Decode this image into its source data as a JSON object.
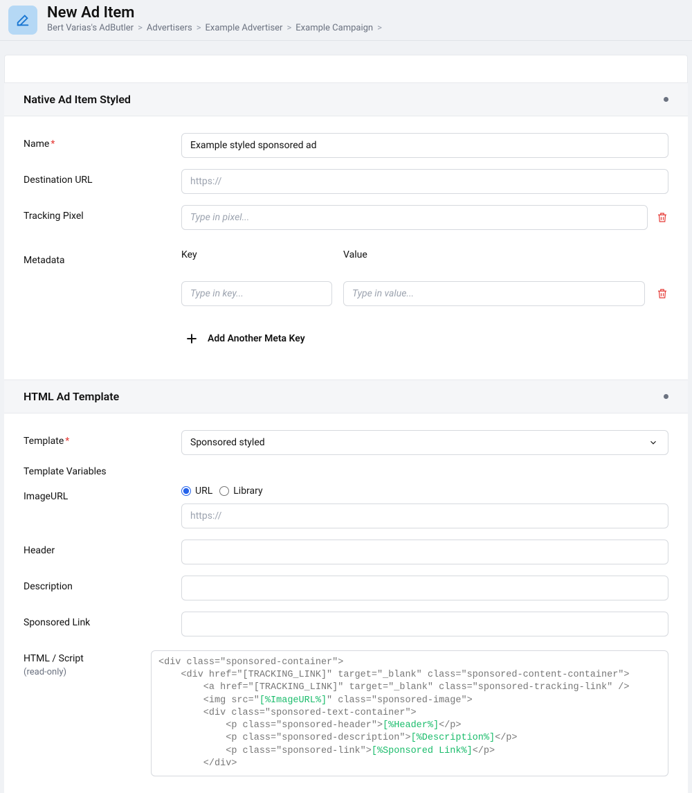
{
  "header": {
    "title": "New Ad Item",
    "breadcrumbs": [
      "Bert Varias's AdButler",
      "Advertisers",
      "Example Advertiser",
      "Example Campaign",
      ""
    ]
  },
  "sections": {
    "native": {
      "title": "Native Ad Item Styled",
      "fields": {
        "name_label": "Name",
        "name_value": "Example styled sponsored ad",
        "dest_label": "Destination URL",
        "dest_placeholder": "https://",
        "pixel_label": "Tracking Pixel",
        "pixel_placeholder": "Type in pixel...",
        "meta_label": "Metadata",
        "meta_key_label": "Key",
        "meta_val_label": "Value",
        "meta_key_placeholder": "Type in key...",
        "meta_val_placeholder": "Type in value...",
        "add_meta_label": "Add Another Meta Key"
      }
    },
    "template": {
      "title": "HTML Ad Template",
      "fields": {
        "template_label": "Template",
        "template_value": "Sponsored styled",
        "vars_heading": "Template Variables",
        "imageurl_label": "ImageURL",
        "radio_url": "URL",
        "radio_library": "Library",
        "imageurl_placeholder": "https://",
        "header_label": "Header",
        "description_label": "Description",
        "sponsored_label": "Sponsored Link",
        "html_label": "HTML / Script",
        "html_sublabel": "(read-only)",
        "code": {
          "l1": "<div class=\"sponsored-container\">",
          "l2": "    <div href=\"[TRACKING_LINK]\" target=\"_blank\" class=\"sponsored-content-container\">",
          "l3a": "        <a href=\"[TRACKING_LINK]\" target=\"_blank\" class=\"sponsored-tracking-link\" />",
          "l4a": "        <img src=\"",
          "l4b": "[%ImageURL%]",
          "l4c": "\" class=\"sponsored-image\">",
          "l5": "        <div class=\"sponsored-text-container\">",
          "l6a": "            <p class=\"sponsored-header\">",
          "l6b": "[%Header%]",
          "l6c": "</p>",
          "l7a": "            <p class=\"sponsored-description\">",
          "l7b": "[%Description%]",
          "l7c": "</p>",
          "l8a": "            <p class=\"sponsored-link\">",
          "l8b": "[%Sponsored Link%]",
          "l8c": "</p>",
          "l9": "        </div>"
        }
      }
    }
  }
}
